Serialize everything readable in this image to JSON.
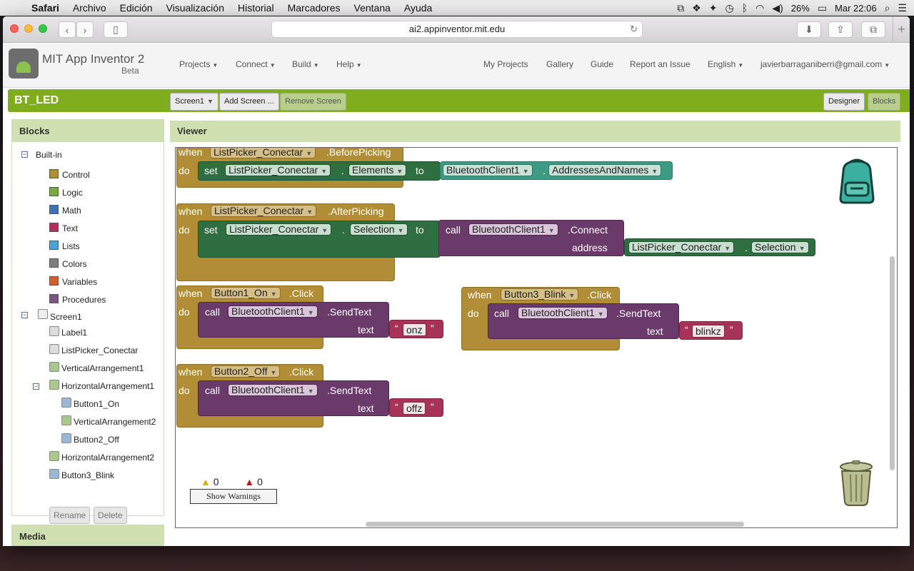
{
  "menubar": {
    "app": "Safari",
    "items": [
      "Archivo",
      "Edición",
      "Visualización",
      "Historial",
      "Marcadores",
      "Ventana",
      "Ayuda"
    ],
    "battery": "26%",
    "clock": "Mar 22:06"
  },
  "browser": {
    "url": "ai2.appinventor.mit.edu"
  },
  "header": {
    "app_name": "MIT App Inventor 2",
    "beta": "Beta",
    "menus": [
      "Projects",
      "Connect",
      "Build",
      "Help"
    ],
    "links": [
      "My Projects",
      "Gallery",
      "Guide",
      "Report an Issue"
    ],
    "language": "English",
    "user": "javierbarraganiberri@gmail.com"
  },
  "toolbar": {
    "project": "BT_LED",
    "screen": "Screen1",
    "add_screen": "Add Screen ...",
    "remove_screen": "Remove Screen",
    "designer": "Designer",
    "blocks": "Blocks"
  },
  "blocks_panel": {
    "title": "Blocks",
    "builtin": "Built-in",
    "builtin_items": [
      {
        "label": "Control",
        "color": "#b18e35"
      },
      {
        "label": "Logic",
        "color": "#77ab41"
      },
      {
        "label": "Math",
        "color": "#3f71b5"
      },
      {
        "label": "Text",
        "color": "#b32d5e"
      },
      {
        "label": "Lists",
        "color": "#49a6d4"
      },
      {
        "label": "Colors",
        "color": "#7d7d7d"
      },
      {
        "label": "Variables",
        "color": "#d05f2d"
      },
      {
        "label": "Procedures",
        "color": "#7c5385"
      }
    ],
    "screen": "Screen1",
    "components": [
      "Label1",
      "ListPicker_Conectar",
      "VerticalArrangement1",
      "HorizontalArrangement1",
      "Button1_On",
      "VerticalArrangement2",
      "Button2_Off",
      "HorizontalArrangement2",
      "Button3_Blink"
    ],
    "rename": "Rename",
    "delete": "Delete",
    "media": "Media"
  },
  "viewer": {
    "title": "Viewer",
    "warnings": "0",
    "errors": "0",
    "show_warnings": "Show Warnings"
  },
  "code": {
    "kw": {
      "when": "when",
      "do": "do",
      "set": "set",
      "to": "to",
      "call": "call",
      "address": "address",
      "text": "text",
      "dot": "."
    },
    "b1": {
      "component": "ListPicker_Conectar",
      "event": ".BeforePicking",
      "set_comp": "ListPicker_Conectar",
      "set_prop": "Elements",
      "get_comp": "BluetoothClient1",
      "get_prop": "AddressesAndNames"
    },
    "b2": {
      "component": "ListPicker_Conectar",
      "event": ".AfterPicking",
      "set_comp": "ListPicker_Conectar",
      "set_prop": "Selection",
      "call_comp": "BluetoothClient1",
      "method": ".Connect",
      "arg_comp": "ListPicker_Conectar",
      "arg_prop": "Selection"
    },
    "b3": {
      "component": "Button1_On",
      "event": ".Click",
      "call_comp": "BluetoothClient1",
      "method": ".SendText",
      "value": "onz"
    },
    "b4": {
      "component": "Button3_Blink",
      "event": ".Click",
      "call_comp": "BluetoothClient1",
      "method": ".SendText",
      "value": "blinkz"
    },
    "b5": {
      "component": "Button2_Off",
      "event": ".Click",
      "call_comp": "BluetoothClient1",
      "method": ".SendText",
      "value": "offz"
    }
  }
}
